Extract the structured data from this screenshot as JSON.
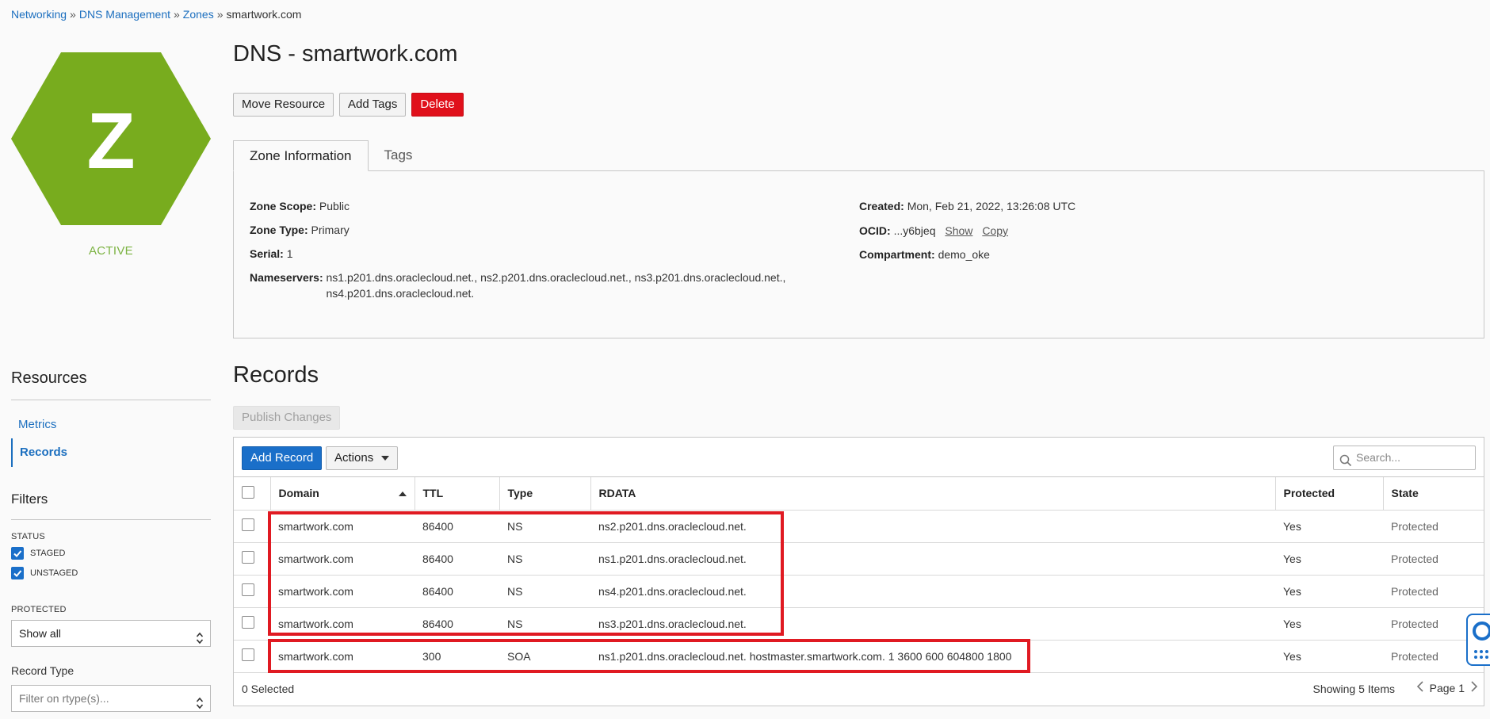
{
  "breadcrumb": {
    "items": [
      "Networking",
      "DNS Management",
      "Zones"
    ],
    "current": "smartwork.com",
    "separator": "»"
  },
  "resource": {
    "icon_letter": "Z",
    "icon_color": "#78ac1e",
    "status": "ACTIVE",
    "status_color": "#7cb342"
  },
  "page_title": "DNS - smartwork.com",
  "actions": {
    "move_resource": "Move Resource",
    "add_tags": "Add Tags",
    "delete": "Delete"
  },
  "tabs": {
    "zone_information": "Zone Information",
    "tags": "Tags"
  },
  "zone_info": {
    "zone_scope_label": "Zone Scope:",
    "zone_scope": "Public",
    "zone_type_label": "Zone Type:",
    "zone_type": "Primary",
    "serial_label": "Serial:",
    "serial": "1",
    "nameservers_label": "Nameservers:",
    "nameservers": "ns1.p201.dns.oraclecloud.net., ns2.p201.dns.oraclecloud.net., ns3.p201.dns.oraclecloud.net., ns4.p201.dns.oraclecloud.net.",
    "created_label": "Created:",
    "created": "Mon, Feb 21, 2022, 13:26:08 UTC",
    "ocid_label": "OCID:",
    "ocid": "...y6bjeq",
    "ocid_show": "Show",
    "ocid_copy": "Copy",
    "compartment_label": "Compartment:",
    "compartment": "demo_oke"
  },
  "sidebar": {
    "resources_heading": "Resources",
    "nav": [
      "Metrics",
      "Records"
    ],
    "active_nav": "Records",
    "filters_heading": "Filters",
    "status_caption": "STATUS",
    "status_options": [
      {
        "label": "STAGED",
        "checked": true
      },
      {
        "label": "UNSTAGED",
        "checked": true
      }
    ],
    "protected_caption": "PROTECTED",
    "protected_value": "Show all",
    "record_type_label": "Record Type",
    "record_type_placeholder": "Filter on rtype(s)..."
  },
  "records": {
    "title": "Records",
    "publish_label": "Publish Changes",
    "add_record_label": "Add Record",
    "actions_label": "Actions",
    "search_placeholder": "Search...",
    "columns": [
      "Domain",
      "TTL",
      "Type",
      "RDATA",
      "Protected",
      "State"
    ],
    "rows": [
      {
        "domain": "smartwork.com",
        "ttl": "86400",
        "type": "NS",
        "rdata": "ns2.p201.dns.oraclecloud.net.",
        "protected": "Yes",
        "state": "Protected"
      },
      {
        "domain": "smartwork.com",
        "ttl": "86400",
        "type": "NS",
        "rdata": "ns1.p201.dns.oraclecloud.net.",
        "protected": "Yes",
        "state": "Protected"
      },
      {
        "domain": "smartwork.com",
        "ttl": "86400",
        "type": "NS",
        "rdata": "ns4.p201.dns.oraclecloud.net.",
        "protected": "Yes",
        "state": "Protected"
      },
      {
        "domain": "smartwork.com",
        "ttl": "86400",
        "type": "NS",
        "rdata": "ns3.p201.dns.oraclecloud.net.",
        "protected": "Yes",
        "state": "Protected"
      },
      {
        "domain": "smartwork.com",
        "ttl": "300",
        "type": "SOA",
        "rdata": "ns1.p201.dns.oraclecloud.net. hostmaster.smartwork.com. 1 3600 600 604800 1800",
        "protected": "Yes",
        "state": "Protected"
      }
    ],
    "selected_text": "0 Selected",
    "showing_text": "Showing 5 Items",
    "page_text": "Page 1"
  },
  "colors": {
    "link_blue": "#1c6fbf",
    "primary_button": "#1a6fc9",
    "danger_button": "#e0101b",
    "highlight_red": "#e01a22"
  }
}
